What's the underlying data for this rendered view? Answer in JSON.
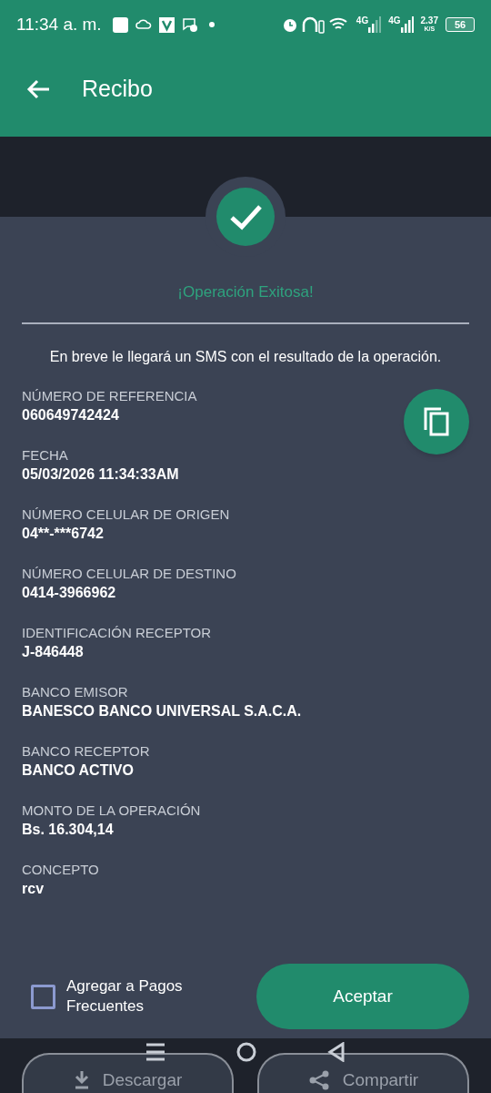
{
  "status_bar": {
    "time": "11:34 a. m.",
    "network_1": "4G",
    "network_2": "4G",
    "speed": "2.37",
    "speed_unit": "K/S",
    "battery": "56"
  },
  "header": {
    "title": "Recibo"
  },
  "result": {
    "title": "¡Operación Exitosa!",
    "message": "En breve le llegará un SMS con el resultado de la operación."
  },
  "fields": [
    {
      "label": "NÚMERO DE REFERENCIA",
      "value": "060649742424"
    },
    {
      "label": "FECHA",
      "value": "05/03/2026 11:34:33AM"
    },
    {
      "label": "NÚMERO CELULAR DE ORIGEN",
      "value": "04**-***6742"
    },
    {
      "label": "NÚMERO CELULAR DE DESTINO",
      "value": "0414-3966962"
    },
    {
      "label": "IDENTIFICACIÓN RECEPTOR",
      "value": "J-846448"
    },
    {
      "label": "BANCO EMISOR",
      "value": "BANESCO BANCO UNIVERSAL S.A.C.A."
    },
    {
      "label": "BANCO RECEPTOR",
      "value": "BANCO ACTIVO"
    },
    {
      "label": "MONTO DE LA OPERACIÓN",
      "value": "Bs. 16.304,14"
    },
    {
      "label": "CONCEPTO",
      "value": "rcv"
    }
  ],
  "frequent_payment": {
    "label": "Agregar a Pagos Frecuentes",
    "checked": false
  },
  "accept_button": "Aceptar",
  "bottom_actions": [
    "Descargar",
    "Compartir"
  ]
}
